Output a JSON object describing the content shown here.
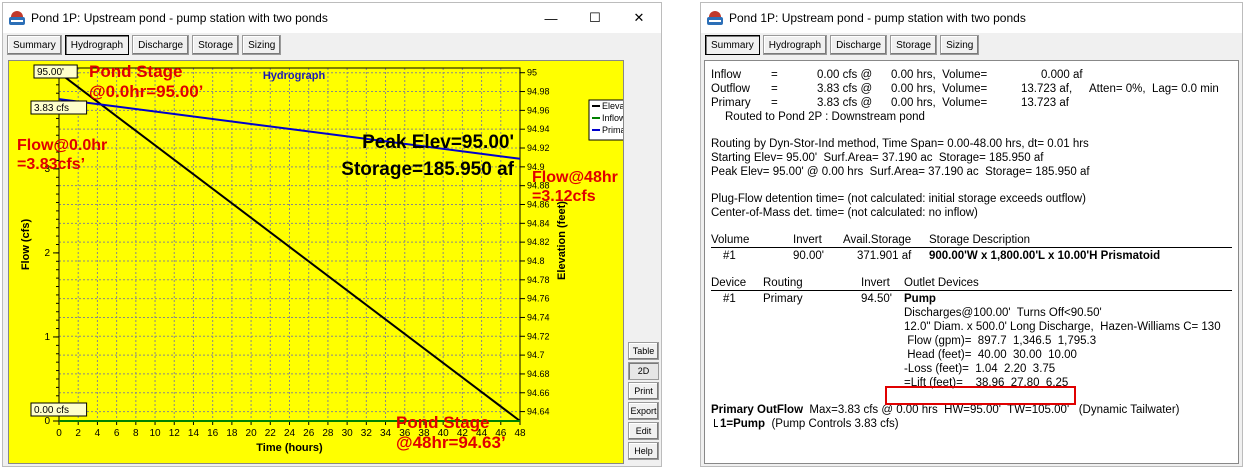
{
  "left_window": {
    "title": "Pond 1P: Upstream pond - pump station with two ponds",
    "controls": {
      "minimize": "—",
      "maximize": "☐",
      "close": "✕"
    },
    "tabs": [
      {
        "label": "Summary"
      },
      {
        "label": "Hydrograph",
        "active": true
      },
      {
        "label": "Discharge"
      },
      {
        "label": "Storage"
      },
      {
        "label": "Sizing"
      }
    ],
    "side_buttons": [
      "Table",
      "2D",
      "Print",
      "Export",
      "Edit",
      "Help"
    ],
    "annotations": {
      "pond_stage_start": "Pond Stage\n@0.0hr=95.00’",
      "flow_start": "Flow@0.0hr\n=3.83cfs’",
      "flow_end": "Flow@48hr\n=3.12cfs",
      "pond_stage_end": "Pond Stage\n@48hr=94.63’"
    }
  },
  "chart_data": {
    "type": "line",
    "title": "Hydrograph",
    "xlabel": "Time (hours)",
    "ylabel": "Flow (cfs)",
    "y2label": "Elevation (feet)",
    "xlim": [
      0,
      48
    ],
    "ylim": [
      0,
      4.2
    ],
    "y2lim": [
      94.63,
      95.005
    ],
    "x_ticks": [
      0,
      2,
      4,
      6,
      8,
      10,
      12,
      14,
      16,
      18,
      20,
      22,
      24,
      26,
      28,
      30,
      32,
      34,
      36,
      38,
      40,
      42,
      44,
      46,
      48
    ],
    "y_ticks": [
      0,
      1,
      2,
      3
    ],
    "y2_ticks": [
      94.64,
      94.66,
      94.68,
      94.7,
      94.72,
      94.74,
      94.76,
      94.78,
      94.8,
      94.82,
      94.84,
      94.86,
      94.88,
      94.9,
      94.92,
      94.94,
      94.96,
      94.98,
      95
    ],
    "markers": {
      "elevation_label": "95.00'",
      "flow_label": "3.83 cfs",
      "zero_label": "0.00 cfs"
    },
    "series": [
      {
        "name": "Elevation",
        "color": "#000000",
        "axis": "y2",
        "x": [
          0,
          48
        ],
        "values": [
          95.0,
          94.63
        ]
      },
      {
        "name": "Inflow",
        "color": "#008000",
        "axis": "y",
        "x": [
          0,
          48
        ],
        "values": [
          0,
          0
        ]
      },
      {
        "name": "Primary",
        "color": "#0000cc",
        "axis": "y",
        "x": [
          0,
          48
        ],
        "values": [
          3.83,
          3.12
        ]
      }
    ],
    "legend_position": "top-right",
    "overlay": {
      "peak": "Peak Elev=95.00'",
      "storage": "Storage=185.950 af"
    },
    "grid": true
  },
  "right_window": {
    "title": "Pond 1P: Upstream pond - pump station with two ponds",
    "tabs": [
      {
        "label": "Summary",
        "active": true
      },
      {
        "label": "Hydrograph"
      },
      {
        "label": "Discharge"
      },
      {
        "label": "Storage"
      },
      {
        "label": "Sizing"
      }
    ],
    "report": {
      "flows": [
        {
          "name": "Inflow",
          "eq": "=",
          "cfs": "0.00 cfs @",
          "hrs": "0.00 hrs,  Volume=",
          "vol": "0.000 af",
          "extra": ""
        },
        {
          "name": "Outflow",
          "eq": "=",
          "cfs": "3.83 cfs @",
          "hrs": "0.00 hrs,  Volume=",
          "vol": "13.723 af,",
          "extra": "Atten= 0%,  Lag= 0.0 min"
        },
        {
          "name": "Primary",
          "eq": "=",
          "cfs": "3.83 cfs @",
          "hrs": "0.00 hrs,  Volume=",
          "vol": "13.723 af",
          "extra": ""
        }
      ],
      "routed_to": "Routed to Pond 2P : Downstream pond",
      "routing_method": "Routing by Dyn-Stor-Ind method, Time Span= 0.00-48.00 hrs, dt= 0.01 hrs",
      "starting_elev": "Starting Elev= 95.00'  Surf.Area= 37.190 ac  Storage= 185.950 af",
      "peak_elev": "Peak Elev= 95.00' @ 0.00 hrs  Surf.Area= 37.190 ac  Storage= 185.950 af",
      "plug_flow": "Plug-Flow detention time= (not calculated: initial storage exceeds outflow)",
      "center_mass": "Center-of-Mass det. time= (not calculated: no inflow)",
      "volume_header": [
        "Volume",
        "Invert",
        "Avail.Storage",
        "Storage Description"
      ],
      "volume_row": [
        "#1",
        "90.00'",
        "371.901 af",
        "900.00'W x 1,800.00'L x 10.00'H Prismatoid"
      ],
      "device_header": [
        "Device",
        "Routing",
        "Invert",
        "Outlet Devices"
      ],
      "device_row": [
        "#1",
        "Primary",
        "94.50'",
        "Pump"
      ],
      "device_details": [
        "Discharges@100.00'  Turns Off<90.50'",
        "12.0\" Diam. x 500.0' Long Discharge,  Hazen-Williams C= 130",
        " Flow (gpm)=  897.7  1,346.5  1,795.3",
        " Head (feet)=  40.00  30.00  10.00",
        "-Loss (feet)=  1.04  2.20  3.75",
        "=Lift (feet)=    38.96  27.80  6.25"
      ],
      "primary_outflow_label": "Primary OutFlow",
      "primary_outflow": "  Max=3.83 cfs @ 0.00 hrs  HW=95.00'  TW=105.00'   (Dynamic Tailwater)",
      "pump_line_label": "1=Pump",
      "pump_line": "  (Pump Controls 3.83 cfs)"
    }
  }
}
